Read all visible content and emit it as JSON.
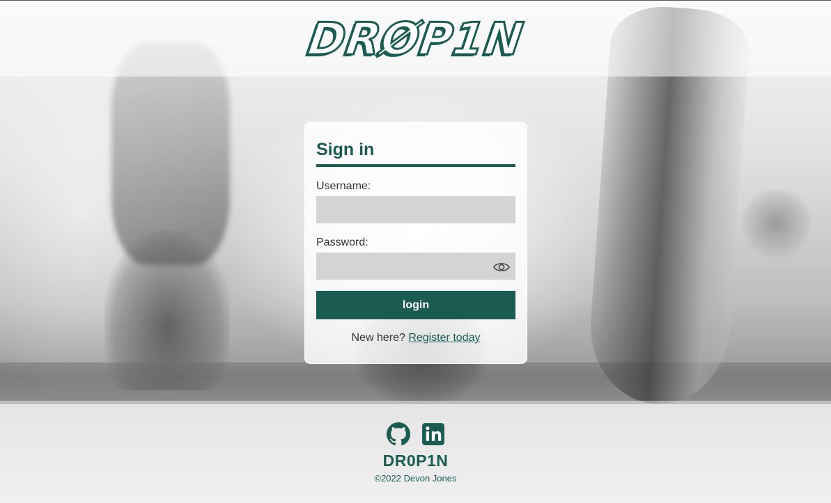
{
  "header": {
    "logo_text": "DRØP1N"
  },
  "signin": {
    "title": "Sign in",
    "username_label": "Username:",
    "username_value": "",
    "password_label": "Password:",
    "password_value": "",
    "login_label": "login",
    "register_prompt": "New here?",
    "register_link": "Register today"
  },
  "footer": {
    "icons": [
      "github-icon",
      "linkedin-icon"
    ],
    "brand": "DR0P1N",
    "copyright": "©2022 Devon Jones"
  },
  "colors": {
    "accent": "#1a5c52",
    "input_bg": "#d4d4d4"
  }
}
